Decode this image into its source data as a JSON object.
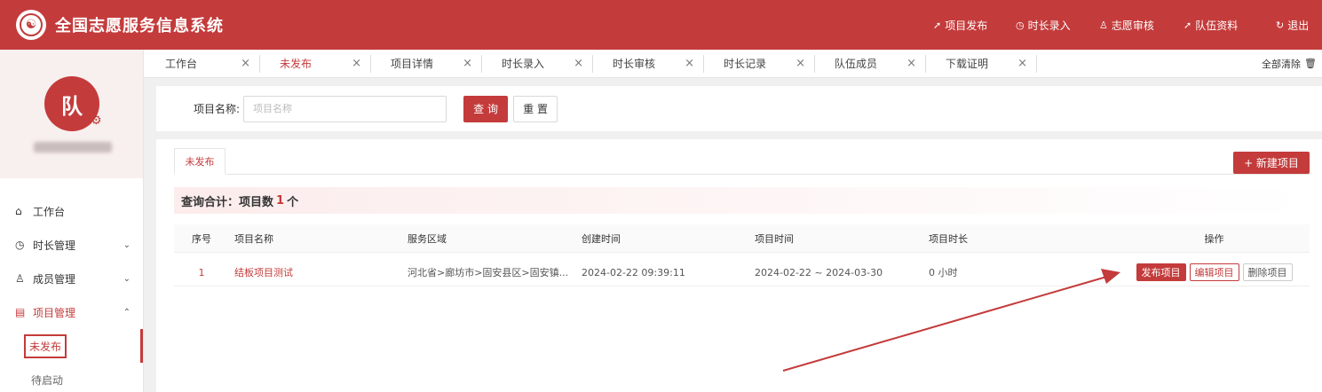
{
  "header": {
    "title": "全国志愿服务信息系统",
    "nav": [
      {
        "label": "项目发布",
        "icon": "send-icon"
      },
      {
        "label": "时长录入",
        "icon": "clock-icon"
      },
      {
        "label": "志愿审核",
        "icon": "user-icon"
      },
      {
        "label": "队伍资料",
        "icon": "send-icon"
      },
      {
        "label": "退出",
        "icon": "logout-icon"
      }
    ]
  },
  "sidebar": {
    "avatar": "队",
    "menu": [
      {
        "label": "工作台"
      },
      {
        "label": "时长管理"
      },
      {
        "label": "成员管理"
      },
      {
        "label": "项目管理"
      }
    ],
    "sub": [
      {
        "label": "未发布"
      },
      {
        "label": "待启动"
      }
    ]
  },
  "tabs": [
    {
      "label": "工作台"
    },
    {
      "label": "未发布"
    },
    {
      "label": "项目详情"
    },
    {
      "label": "时长录入"
    },
    {
      "label": "时长审核"
    },
    {
      "label": "时长记录"
    },
    {
      "label": "队伍成员"
    },
    {
      "label": "下载证明"
    }
  ],
  "tabs_clear": "全部清除",
  "search": {
    "label": "项目名称:",
    "placeholder": "项目名称",
    "query": "查 询",
    "reset": "重 置"
  },
  "main": {
    "tab": "未发布",
    "new_button": "+ 新建项目",
    "summary_prefix": "查询合计：项目数",
    "summary_count": "1",
    "summary_suffix": "个",
    "columns": [
      "序号",
      "项目名称",
      "服务区域",
      "创建时间",
      "项目时间",
      "项目时长",
      "操作"
    ],
    "rows": [
      {
        "idx": "1",
        "name": "结板项目测试",
        "area": "河北省>廊坊市>固安县区>固安镇...",
        "created": "2024-02-22 09:39:11",
        "time": "2024-02-22 ~ 2024-03-30",
        "duration": "0 小时",
        "ops": {
          "publish": "发布项目",
          "edit": "编辑项目",
          "delete": "删除项目"
        }
      }
    ]
  },
  "colors": {
    "accent": "#c43b3b"
  }
}
